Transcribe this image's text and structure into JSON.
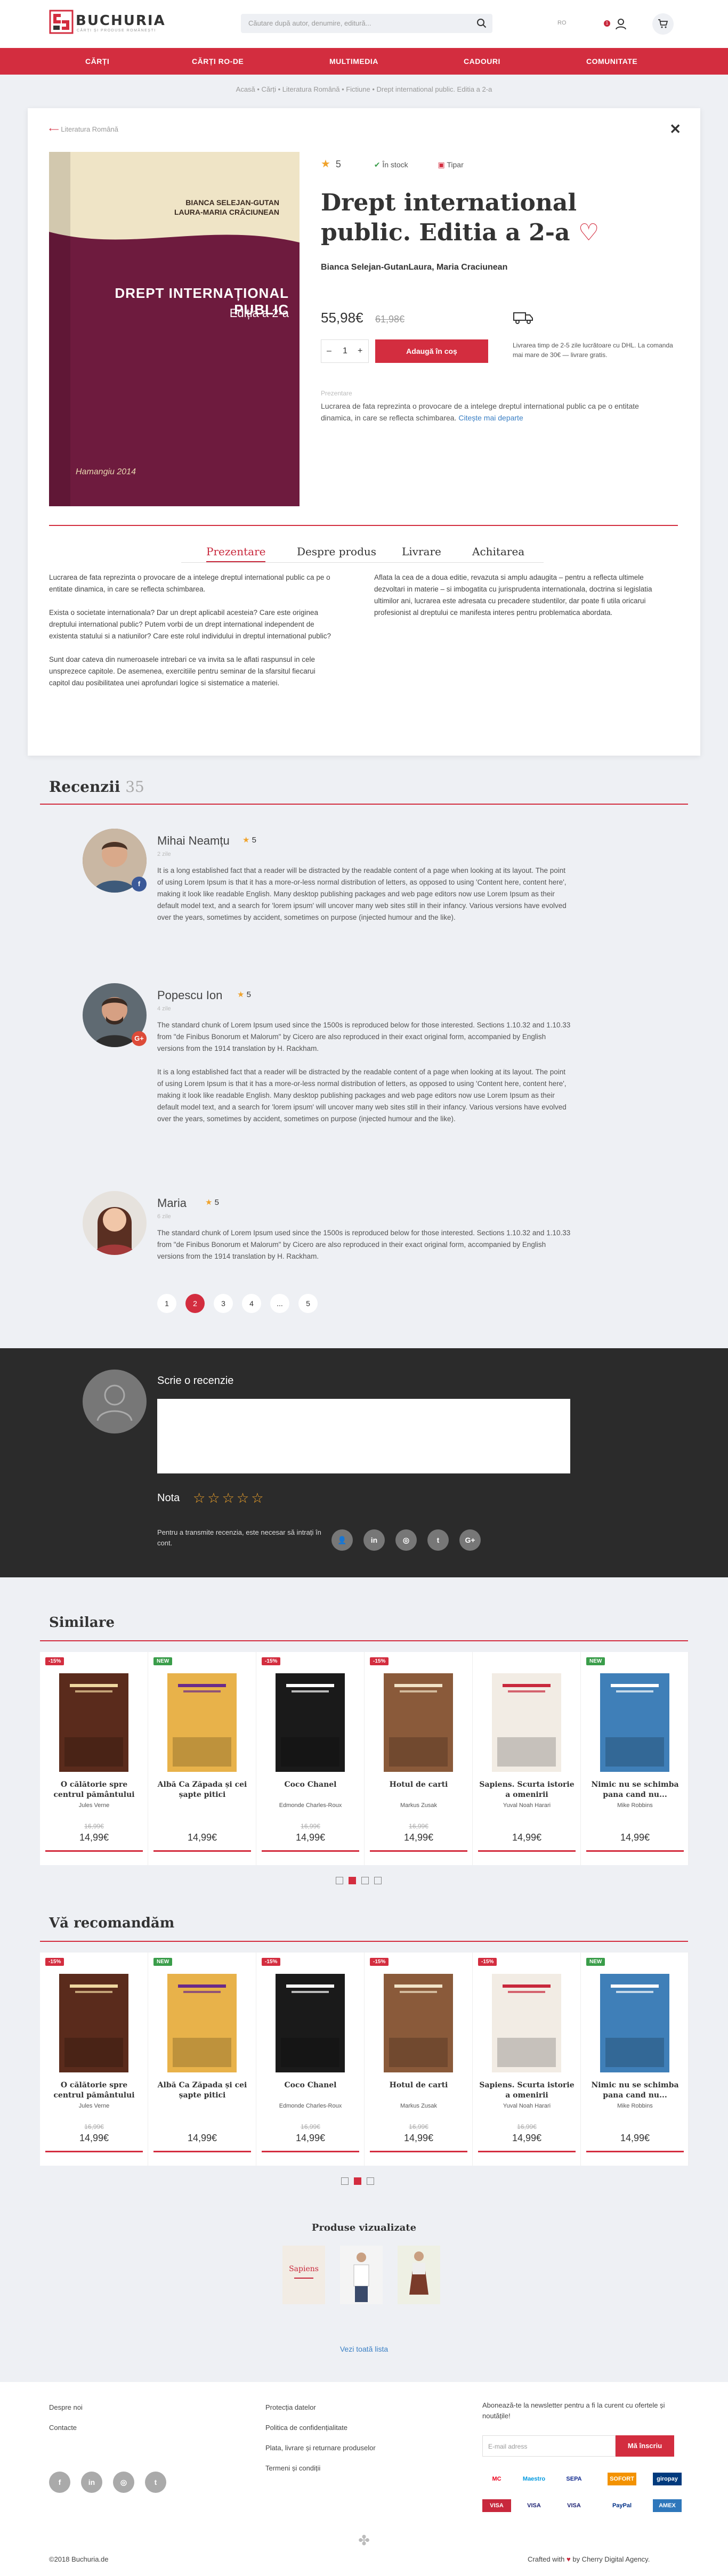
{
  "header": {
    "logo_name": "BUCHURIA",
    "logo_tag": "CĂRȚI ȘI PRODUSE ROMÂNEȘTI",
    "search_placeholder": "Căutare după autor, denumire, editură...",
    "lang": "RO",
    "notif_count": "1"
  },
  "nav": [
    "CĂRȚI",
    "CĂRȚI RO-DE",
    "MULTIMEDIA",
    "CADOURI",
    "COMUNITATE"
  ],
  "breadcrumb": "Acasă  •  Cărți  •  Literatura Română  •  Fictiune  •  Drept international public. Editia a 2-a",
  "product": {
    "back_label": "Literatura Română",
    "cover_authors": "BIANCA SELEJAN-GUTAN\nLAURA-MARIA CRĂCIUNEAN",
    "cover_title": "DREPT INTERNAȚIONAL PUBLIC",
    "cover_edition": "Ediția a 2-a",
    "cover_publisher": "Hamangiu 2014",
    "rating": "5",
    "stock": "În stock",
    "format": "Tipar",
    "title": "Drept international public. Editia a 2-a",
    "authors": "Bianca Selejan-GutanLaura, Maria Craciunean",
    "price": "55,98€",
    "old_price": "61,98€",
    "qty": "1",
    "add_to_cart": "Adaugă în coș",
    "shipping": "Livrarea timp de 2-5 zile lucrătoare cu DHL. La comanda mai mare de 30€ — livrare gratis.",
    "desc_label": "Prezentare",
    "desc": "Lucrarea de fata reprezinta o provocare de a intelege dreptul international public ca pe o entitate dinamica, in care se reflecta schimbarea.",
    "read_more": "Citește mai departe"
  },
  "tabs": [
    "Prezentare",
    "Despre produs",
    "Livrare",
    "Achitarea"
  ],
  "presentation": {
    "left": [
      "Lucrarea de fata reprezinta o provocare de a intelege dreptul international public ca pe o entitate dinamica, in care se reflecta schimbarea.",
      "Exista o societate internationala? Dar un drept aplicabil acesteia? Care este originea dreptului international public? Putem vorbi de un drept international independent de existenta statului si a natiunilor? Care este rolul individului in dreptul international public?",
      "Sunt doar cateva din numeroasele intrebari ce va invita sa le aflati raspunsul in cele unsprezece capitole. De asemenea, exercitiile pentru seminar de la sfarsitul fiecarui capitol dau posibilitatea unei aprofundari logice si sistematice a materiei."
    ],
    "right": "Aflata la cea de a doua editie, revazuta si amplu adaugita – pentru a reflecta ultimele dezvoltari in materie – si imbogatita cu jurisprudenta internationala, doctrina si legislatia ultimilor ani, lucrarea este adresata cu precadere studentilor, dar poate fi utila oricarui profesionist al dreptului ce manifesta interes pentru problematica abordata."
  },
  "reviews": {
    "title": "Recenzii",
    "count": "35",
    "items": [
      {
        "name": "Mihai Neamțu",
        "rating": "5",
        "date": "2 zile",
        "social": "f",
        "paras": [
          "It is a long established fact that a reader will be distracted by the readable content of a page when looking at its layout. The point of using Lorem Ipsum is that it has a more-or-less normal distribution of letters, as opposed to using 'Content here, content here', making it look like readable English. Many desktop publishing packages and web page editors now use Lorem Ipsum as their default model text, and a search for 'lorem ipsum' will uncover many web sites still in their infancy. Various versions have evolved over the years, sometimes by accident, sometimes on purpose (injected humour and the like)."
        ]
      },
      {
        "name": "Popescu Ion",
        "rating": "5",
        "date": "4 zile",
        "social": "G+",
        "paras": [
          "The standard chunk of Lorem Ipsum used since the 1500s is reproduced below for those interested. Sections 1.10.32 and 1.10.33 from \"de Finibus Bonorum et Malorum\" by Cicero are also reproduced in their exact original form, accompanied by English versions from the 1914 translation by H. Rackham.",
          "It is a long established fact that a reader will be distracted by the readable content of a page when looking at its layout. The point of using Lorem Ipsum is that it has a more-or-less normal distribution of letters, as opposed to using 'Content here, content here', making it look like readable English. Many desktop publishing packages and web page editors now use Lorem Ipsum as their default model text, and a search for 'lorem ipsum' will uncover many web sites still in their infancy. Various versions have evolved over the years, sometimes by accident, sometimes on purpose (injected humour and the like)."
        ]
      },
      {
        "name": "Maria",
        "rating": "5",
        "date": "6 zile",
        "social": "",
        "paras": [
          "The standard chunk of Lorem Ipsum used since the 1500s is reproduced below for those interested. Sections 1.10.32 and 1.10.33 from \"de Finibus Bonorum et Malorum\" by Cicero are also reproduced in their exact original form, accompanied by English versions from the 1914 translation by H. Rackham."
        ]
      }
    ],
    "pages": [
      "1",
      "2",
      "3",
      "4",
      "...",
      "5"
    ]
  },
  "write_review": {
    "title": "Scrie o recenzie",
    "rating_label": "Nota",
    "login_note": "Pentru a transmite recenzia, este necesar să intrați în cont."
  },
  "similar": {
    "title": "Similare",
    "items": [
      {
        "badge": "-15%",
        "title": "O călătorie spre centrul pământului",
        "author": "Jules Verne",
        "old": "16,99€",
        "price": "14,99€"
      },
      {
        "badge": "NEW",
        "title": "Albă Ca Zăpada și cei șapte pitici",
        "author": "",
        "old": "",
        "price": "14,99€"
      },
      {
        "badge": "-15%",
        "title": "Coco Chanel",
        "author": "Edmonde Charles-Roux",
        "old": "16,99€",
        "price": "14,99€"
      },
      {
        "badge": "-15%",
        "title": "Hotul de carti",
        "author": "Markus Zusak",
        "old": "16,99€",
        "price": "14,99€"
      },
      {
        "badge": "",
        "title": "Sapiens. Scurta istorie a omenirii",
        "author": "Yuval Noah Harari",
        "old": "",
        "price": "14,99€"
      },
      {
        "badge": "NEW",
        "title": "Nimic nu se schimba pana cand nu...",
        "author": "Mike Robbins",
        "old": "",
        "price": "14,99€"
      }
    ]
  },
  "recommend": {
    "title": "Vă recomandăm",
    "items": [
      {
        "badge": "-15%",
        "title": "O călătorie spre centrul pământului",
        "author": "Jules Verne",
        "old": "16,99€",
        "price": "14,99€"
      },
      {
        "badge": "NEW",
        "title": "Albă Ca Zăpada și cei șapte pitici",
        "author": "",
        "old": "",
        "price": "14,99€"
      },
      {
        "badge": "-15%",
        "title": "Coco Chanel",
        "author": "Edmonde Charles-Roux",
        "old": "16,99€",
        "price": "14,99€"
      },
      {
        "badge": "-15%",
        "title": "Hotul de carti",
        "author": "Markus Zusak",
        "old": "16,99€",
        "price": "14,99€"
      },
      {
        "badge": "-15%",
        "title": "Sapiens. Scurta istorie a omenirii",
        "author": "Yuval Noah Harari",
        "old": "16,99€",
        "price": "14,99€"
      },
      {
        "badge": "NEW",
        "title": "Nimic nu se schimba pana cand nu...",
        "author": "Mike Robbins",
        "old": "",
        "price": "14,99€"
      }
    ]
  },
  "viewed": {
    "title": "Produse vizualizate",
    "see_all": "Vezi toată lista"
  },
  "footer": {
    "col1": [
      "Despre noi",
      "Contacte"
    ],
    "col2": [
      "Protecția datelor",
      "Politica de confidențialitate",
      "Plata, livrare și returnare produselor",
      "Termeni și condiții"
    ],
    "newsletter": "Abonează-te la newsletter pentru a fi la curent cu ofertele și noutățile!",
    "email_placeholder": "E-mail adress",
    "subscribe": "Mă înscriu",
    "payments": [
      "MC",
      "Maestro",
      "SEPA",
      "SOFORT",
      "giropay",
      "VISA",
      "VISA",
      "PayPal",
      "AMEX"
    ],
    "copyright": "©2018 Buchuria.de",
    "credit_a": "Crafted with",
    "credit_b": "by Cherry Digital Agency."
  },
  "colors": {
    "accent": "#d32d3f",
    "dark": "#2b2b2b",
    "star": "#f0a32b",
    "link": "#3a7fc4"
  }
}
